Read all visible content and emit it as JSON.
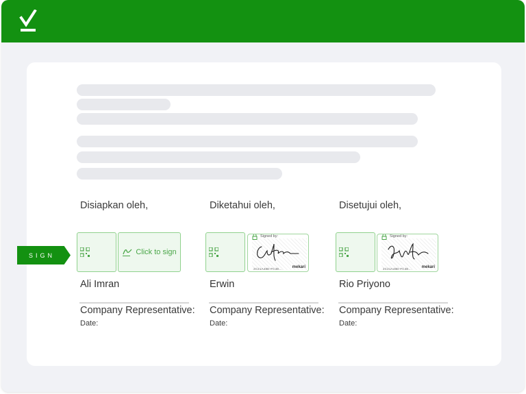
{
  "sign_tag_label": "SIGN",
  "placeholder_action": "Click to sign",
  "signers": [
    {
      "role": "Disiapkan oleh,",
      "name": "Ali Imran",
      "title": "Company Representative:",
      "date_label": "Date:",
      "status": "unsigned"
    },
    {
      "role": "Diketahui oleh,",
      "name": "Erwin",
      "title": "Company Representative:",
      "date_label": "Date:",
      "status": "signed",
      "signed_by_label": "Signed by:",
      "hash": "2C21A48D-FC3E...",
      "brand": "mekari"
    },
    {
      "role": "Disetujui oleh,",
      "name": "Rio Priyono",
      "title": "Company Representative:",
      "date_label": "Date:",
      "status": "signed",
      "signed_by_label": "Signed by:",
      "hash": "2C21A48D-FC3E...",
      "brand": "mekari"
    }
  ],
  "colors": {
    "brand_green": "#139111",
    "field_border": "#8fd18d",
    "field_fill": "#eef8ee",
    "text_placeholder": "#e8e9ed"
  },
  "icons": [
    "check-logo-icon",
    "qr-code-icon",
    "signature-pen-icon",
    "lock-icon"
  ]
}
